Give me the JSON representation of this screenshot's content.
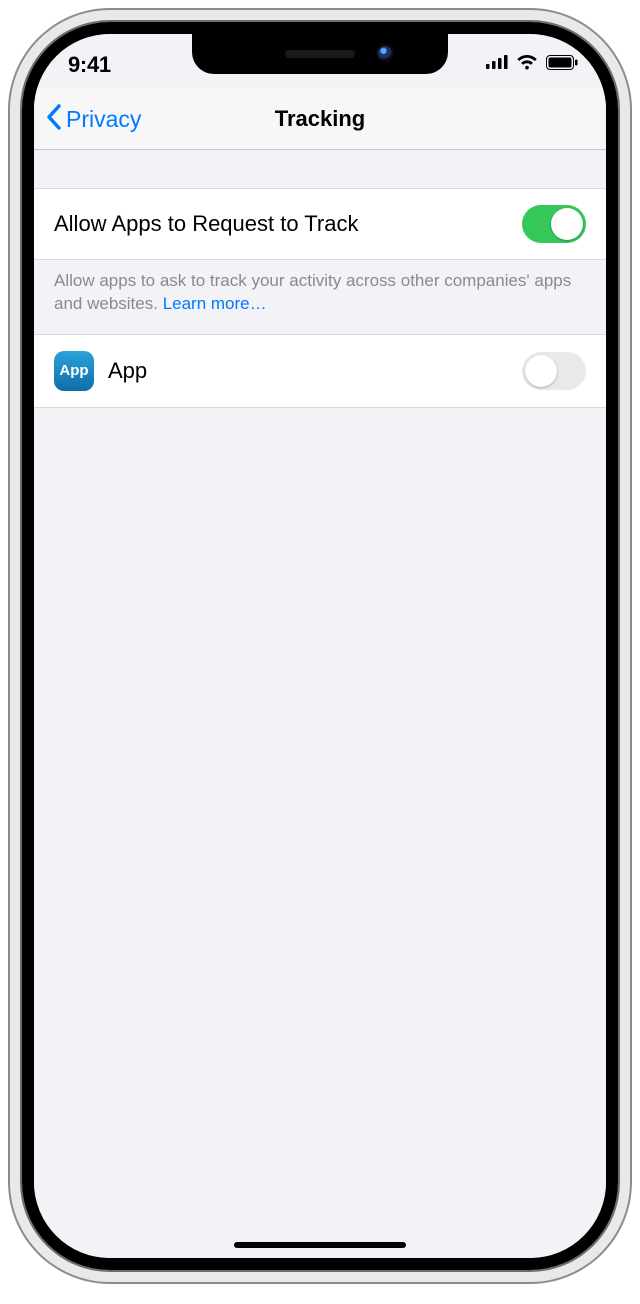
{
  "status": {
    "time": "9:41"
  },
  "nav": {
    "back_label": "Privacy",
    "title": "Tracking"
  },
  "settings": {
    "allow_row": {
      "label": "Allow Apps to Request to Track",
      "enabled": true
    },
    "footer_text": "Allow apps to ask to track your activity across other companies' apps and websites. ",
    "footer_link": "Learn more…"
  },
  "apps": [
    {
      "icon_text": "App",
      "name": "App",
      "tracking_enabled": false
    }
  ],
  "colors": {
    "tint": "#007aff",
    "toggle_on": "#34c759",
    "bg": "#f2f2f7"
  }
}
